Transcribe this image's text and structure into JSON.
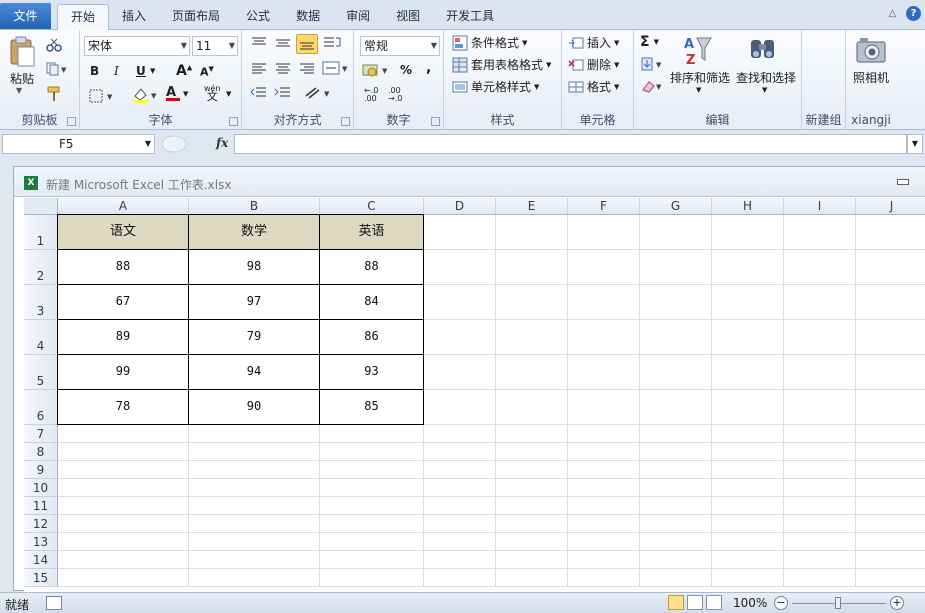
{
  "tabs": {
    "file": "文件",
    "items": [
      "开始",
      "插入",
      "页面布局",
      "公式",
      "数据",
      "审阅",
      "视图",
      "开发工具"
    ],
    "active": "开始"
  },
  "ribbon": {
    "clipboard": {
      "label": "剪贴板",
      "paste": "粘贴"
    },
    "font": {
      "label": "字体",
      "name": "宋体",
      "size": "11",
      "bold": "B",
      "italic": "I",
      "underline": "U",
      "font_color_letter": "A",
      "phonetic": "wén"
    },
    "alignment": {
      "label": "对齐方式"
    },
    "number": {
      "label": "数字",
      "format": "常规",
      "percent": "%",
      "comma": ","
    },
    "styles": {
      "label": "样式",
      "conditional": "条件格式",
      "table": "套用表格格式",
      "cell_styles": "单元格样式"
    },
    "cells": {
      "label": "单元格",
      "insert": "插入",
      "delete": "删除",
      "format": "格式"
    },
    "editing": {
      "label": "编辑",
      "sort": "排序和筛选",
      "find": "查找和选择",
      "sigma": "Σ"
    },
    "newgroup": {
      "label": "新建组"
    },
    "xiangji": {
      "label": "xiangji",
      "camera": "照相机"
    }
  },
  "formula_bar": {
    "name_box": "F5",
    "fx": "fx",
    "value": ""
  },
  "workbook": {
    "title": "新建 Microsoft Excel 工作表.xlsx"
  },
  "sheet": {
    "columns": [
      "A",
      "B",
      "C",
      "D",
      "E",
      "F",
      "G",
      "H",
      "I",
      "J"
    ],
    "rows": [
      "1",
      "2",
      "3",
      "4",
      "5",
      "6",
      "7",
      "8",
      "9",
      "10",
      "11",
      "12",
      "13",
      "14",
      "15"
    ],
    "headers": [
      "语文",
      "数学",
      "英语"
    ],
    "data": [
      [
        "88",
        "98",
        "88"
      ],
      [
        "67",
        "97",
        "84"
      ],
      [
        "89",
        "79",
        "86"
      ],
      [
        "99",
        "94",
        "93"
      ],
      [
        "78",
        "90",
        "85"
      ]
    ]
  },
  "status": {
    "ready": "就绪",
    "zoom": "100%",
    "minus": "−",
    "plus": "+"
  },
  "colors": {
    "header_fill": "#ddd9c3",
    "file_tab": "#2b6bbf"
  }
}
